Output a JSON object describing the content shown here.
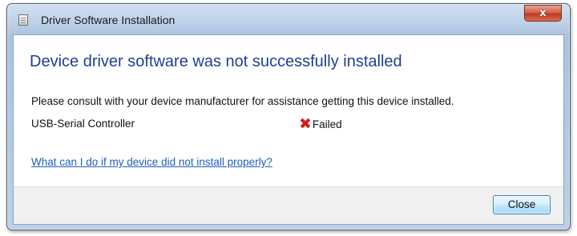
{
  "window": {
    "title": "Driver Software Installation",
    "title_icon": "installer-document-icon",
    "close_glyph": "x"
  },
  "content": {
    "heading": "Device driver software was not successfully installed",
    "message": "Please consult with your device manufacturer for assistance getting this device installed.",
    "device": {
      "name": "USB-Serial Controller",
      "status_icon": "red-x-failed-icon",
      "status": "Failed"
    },
    "help_link": "What can I do if my device did not install properly?"
  },
  "footer": {
    "close_label": "Close"
  },
  "colors": {
    "heading": "#1e3f8f",
    "link": "#1f5fb8",
    "failed_icon": "#d81a1a",
    "title_close_button": "#c0391f",
    "frame": "#bcd0e8"
  }
}
